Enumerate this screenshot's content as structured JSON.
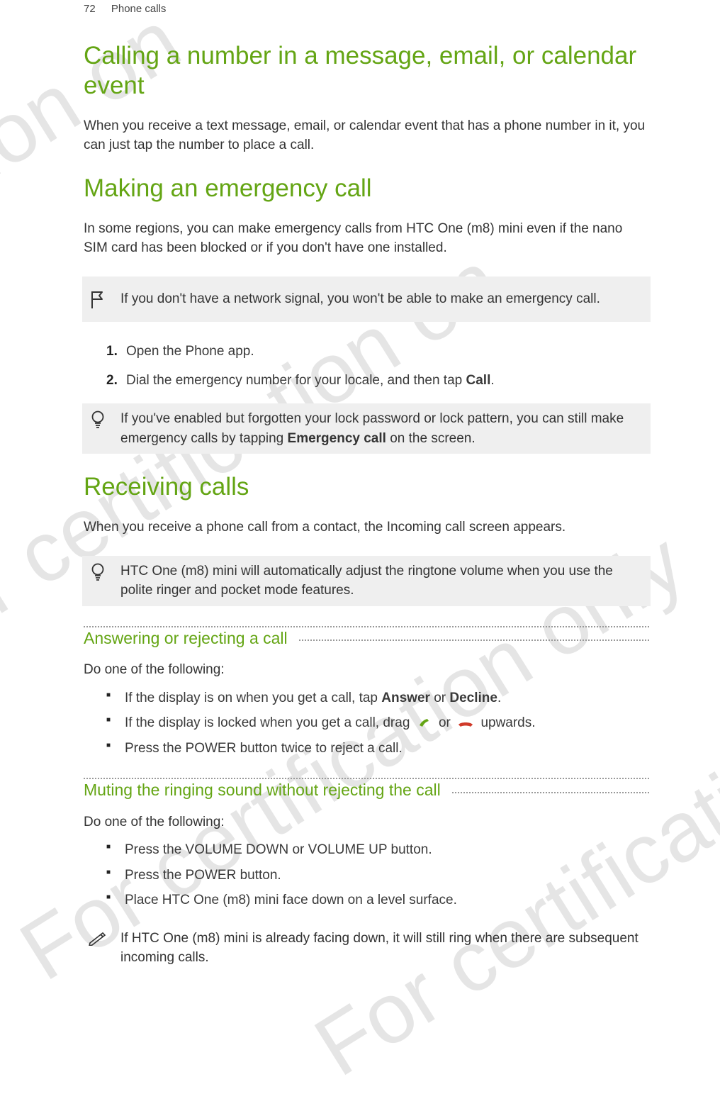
{
  "watermarks": [
    "tification on",
    "For certification on",
    "For certification only",
    "For certificatio"
  ],
  "header": {
    "page_number": "72",
    "section": "Phone calls"
  },
  "s1": {
    "title": "Calling a number in a message, email, or calendar event",
    "body": "When you receive a text message, email, or calendar event that has a phone number in it, you can just tap the number to place a call."
  },
  "s2": {
    "title": "Making an emergency call",
    "body": "In some regions, you can make emergency calls from HTC One (m8) mini even if the nano SIM card has been blocked or if you don't have one installed.",
    "warning": "If you don't have a network signal, you won't be able to make an emergency call.",
    "steps": {
      "n1": "1.",
      "t1": "Open the Phone app.",
      "n2": "2.",
      "t2_a": "Dial the emergency number for your locale, and then tap ",
      "t2_b": "Call",
      "t2_c": "."
    },
    "tip_a": "If you've enabled but forgotten your lock password or lock pattern, you can still make emergency calls by tapping ",
    "tip_b": "Emergency call",
    "tip_c": " on the screen."
  },
  "s3": {
    "title": "Receiving calls",
    "body": "When you receive a phone call from a contact, the Incoming call screen appears.",
    "tip": "HTC One (m8) mini will automatically adjust the ringtone volume when you use the polite ringer and pocket mode features.",
    "sub1": {
      "title": "Answering or rejecting a call",
      "lead": "Do one of the following:",
      "b1_a": "If the display is on when you get a call, tap ",
      "b1_b": "Answer",
      "b1_c": " or ",
      "b1_d": "Decline",
      "b1_e": ".",
      "b2_a": "If the display is locked when you get a call, drag ",
      "b2_b": " or ",
      "b2_c": " upwards.",
      "b3": "Press the POWER button twice to reject a call."
    },
    "sub2": {
      "title": "Muting the ringing sound without rejecting the call",
      "lead": "Do one of the following:",
      "b1": "Press the VOLUME DOWN or VOLUME UP button.",
      "b2": "Press the POWER button.",
      "b3": "Place HTC One (m8) mini face down on a level surface."
    },
    "note": "If HTC One (m8) mini is already facing down, it will still ring when there are subsequent incoming calls."
  }
}
